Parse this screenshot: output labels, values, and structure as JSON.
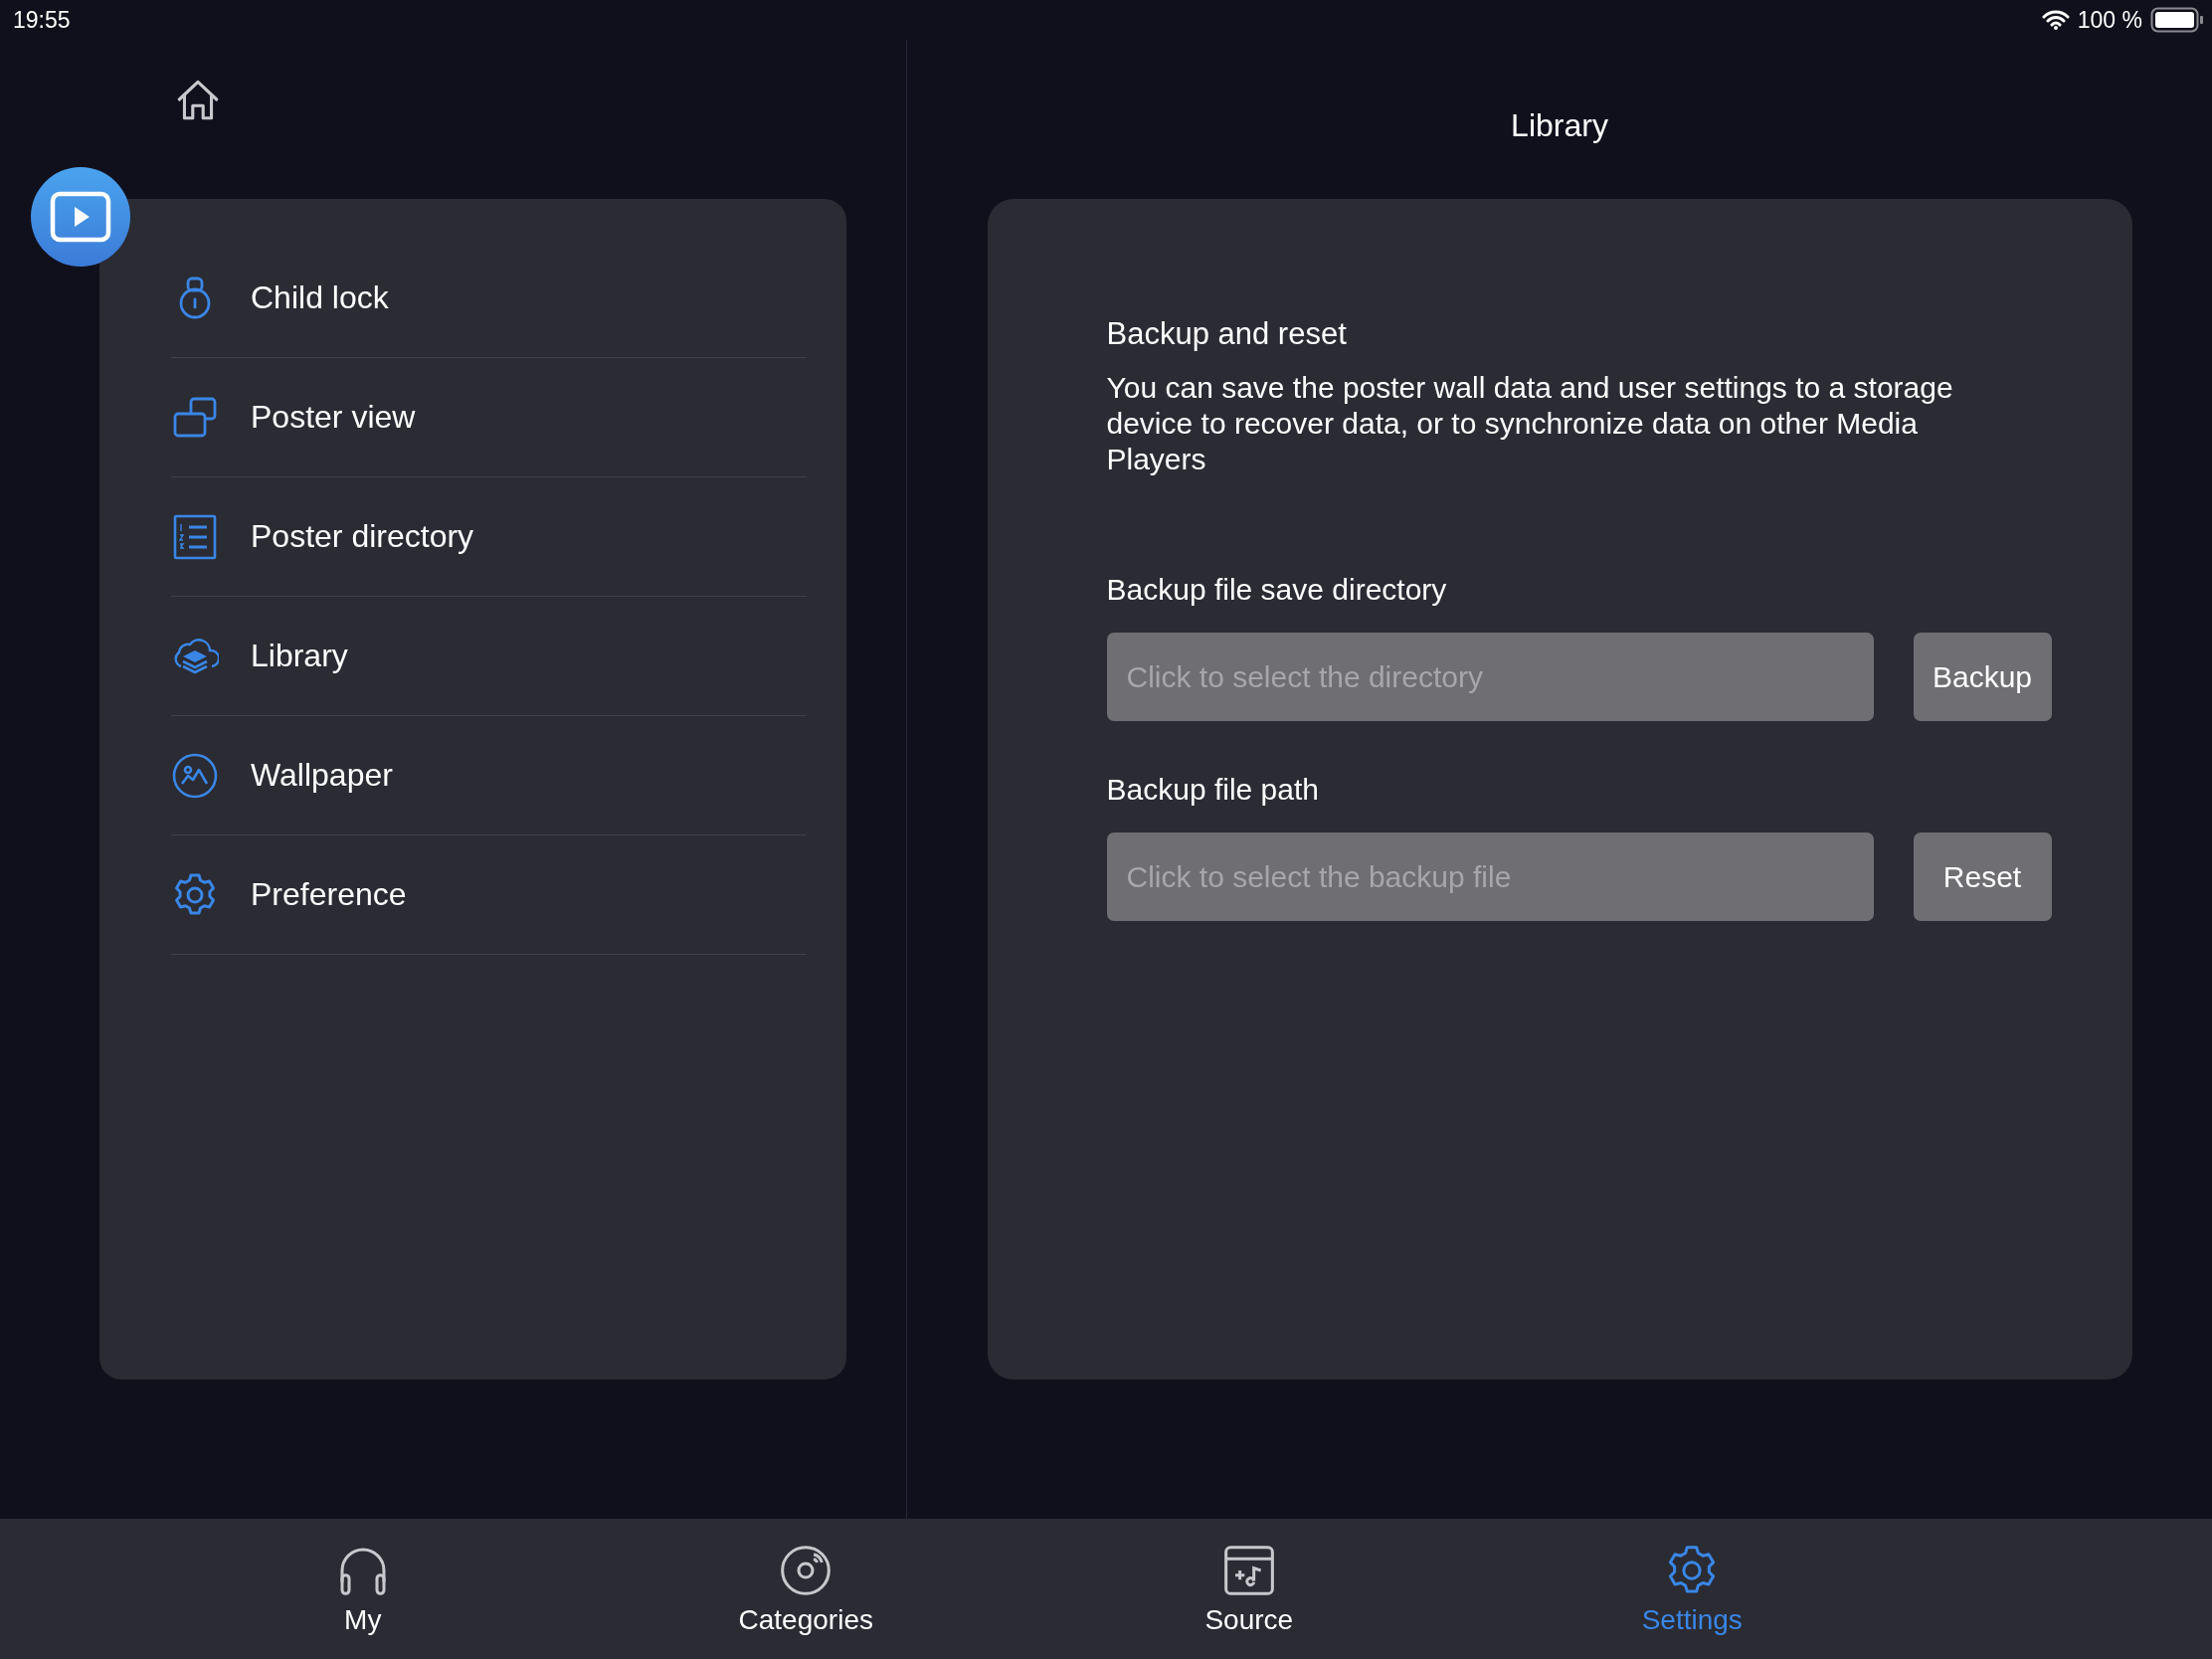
{
  "status_bar": {
    "time": "19:55",
    "battery": "100 %"
  },
  "header": {
    "title": "Library"
  },
  "menu": [
    {
      "kind": "lock",
      "label": "Child lock"
    },
    {
      "kind": "windows",
      "label": "Poster view"
    },
    {
      "kind": "list",
      "label": "Poster directory"
    },
    {
      "kind": "cloud",
      "label": "Library"
    },
    {
      "kind": "picture",
      "label": "Wallpaper"
    },
    {
      "kind": "gear",
      "label": "Preference"
    }
  ],
  "panel": {
    "heading": "Backup and reset",
    "description": "You can save the poster wall data and user settings to a storage device to recover data, or to synchronize data on other Media Players",
    "fields": [
      {
        "label": "Backup file save directory",
        "placeholder": "Click to select the directory",
        "button": "Backup"
      },
      {
        "label": "Backup file path",
        "placeholder": "Click to select the backup file",
        "button": "Reset"
      }
    ]
  },
  "tabs": [
    {
      "kind": "headphones",
      "label": "My",
      "selected": false
    },
    {
      "kind": "disc",
      "label": "Categories",
      "selected": false
    },
    {
      "kind": "source",
      "label": "Source",
      "selected": false
    },
    {
      "kind": "gear",
      "label": "Settings",
      "selected": true
    }
  ]
}
